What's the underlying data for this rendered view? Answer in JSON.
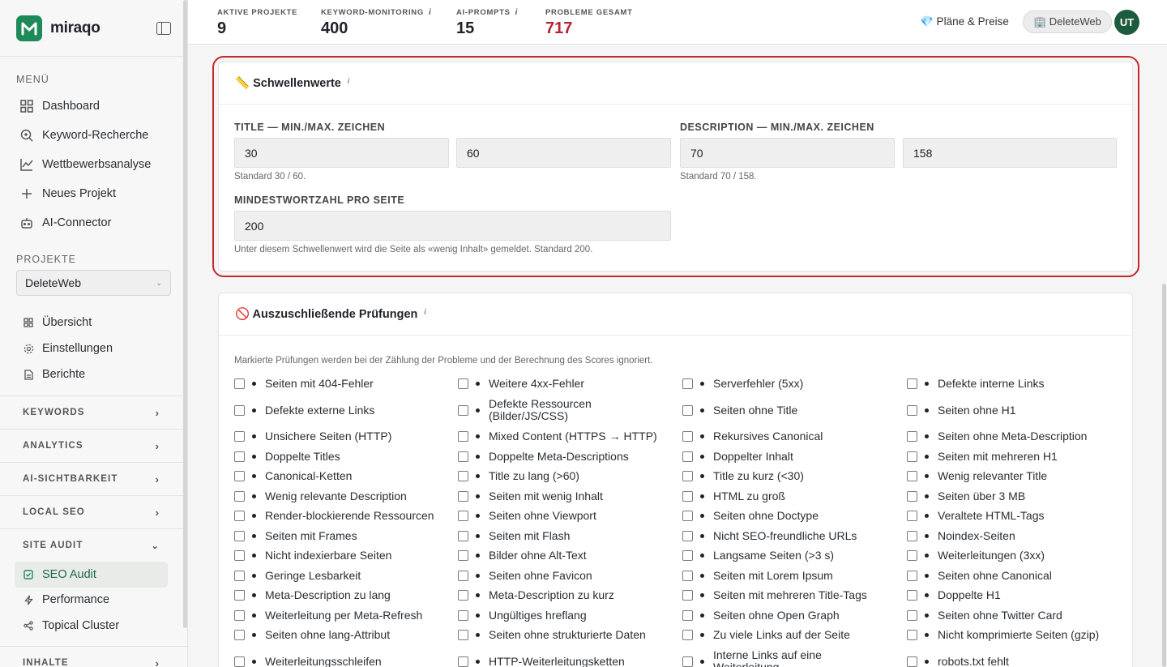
{
  "app": {
    "name": "miraqo"
  },
  "sidebar": {
    "menu_title": "MENÜ",
    "menu": [
      {
        "label": "Dashboard",
        "icon": "grid-icon"
      },
      {
        "label": "Keyword-Recherche",
        "icon": "search-icon"
      },
      {
        "label": "Wettbewerbsanalyse",
        "icon": "chart-line-icon"
      },
      {
        "label": "Neues Projekt",
        "icon": "plus-icon"
      },
      {
        "label": "AI-Connector",
        "icon": "robot-icon"
      }
    ],
    "projects_title": "PROJEKTE",
    "project_select": "DeleteWeb",
    "project_items": [
      {
        "label": "Übersicht",
        "icon": "grid-icon"
      },
      {
        "label": "Einstellungen",
        "icon": "gear-icon"
      },
      {
        "label": "Berichte",
        "icon": "document-icon"
      }
    ],
    "groups": [
      "KEYWORDS",
      "ANALYTICS",
      "AI-SICHTBARKEIT",
      "LOCAL SEO"
    ],
    "site_audit": {
      "title": "SITE AUDIT",
      "items": [
        {
          "label": "SEO Audit",
          "icon": "check-square-icon",
          "active": true
        },
        {
          "label": "Performance",
          "icon": "bolt-icon"
        },
        {
          "label": "Topical Cluster",
          "icon": "share-icon"
        }
      ]
    },
    "inhalte": "INHALTE"
  },
  "topbar": {
    "kpis": [
      {
        "label": "AKTIVE PROJEKTE",
        "value": "9",
        "info": ""
      },
      {
        "label": "KEYWORD-MONITORING",
        "value": "400",
        "info": "i"
      },
      {
        "label": "AI-PROMPTS",
        "value": "15",
        "info": "i"
      },
      {
        "label": "PROBLEME GESAMT",
        "value": "717",
        "info": ""
      }
    ],
    "plans": "💎 Pläne & Preise",
    "project": "🏢 DeleteWeb",
    "avatar": "UT",
    "colors": {
      "problems": "#b3262d",
      "avatar": "#1d5b3f",
      "brand": "#1e8a5a"
    }
  },
  "thresholds": {
    "title": "📏 Schwellenwerte",
    "info": "i",
    "title_label": "TITLE — MIN./MAX. ZEICHEN",
    "title_min": "30",
    "title_max": "60",
    "title_hint": "Standard 30 / 60.",
    "desc_label": "DESCRIPTION — MIN./MAX. ZEICHEN",
    "desc_min": "70",
    "desc_max": "158",
    "desc_hint": "Standard 70 / 158.",
    "words_label": "MINDESTWORTZAHL PRO SEITE",
    "words_value": "200",
    "words_hint": "Unter diesem Schwellenwert wird die Seite als «wenig Inhalt» gemeldet. Standard 200."
  },
  "exclusions": {
    "title": "🚫 Auszuschließende Prüfungen",
    "info": "i",
    "description": "Markierte Prüfungen werden bei der Zählung der Probleme und der Berechnung des Scores ignoriert.",
    "rows": [
      [
        "Seiten mit 404-Fehler",
        "Weitere 4xx-Fehler",
        "Serverfehler (5xx)",
        "Defekte interne Links"
      ],
      [
        "Defekte externe Links",
        "Defekte Ressourcen (Bilder/JS/CSS)",
        "Seiten ohne Title",
        "Seiten ohne H1"
      ],
      [
        "Unsichere Seiten (HTTP)",
        "Mixed Content (HTTPS → HTTP)",
        "Rekursives Canonical",
        "Seiten ohne Meta-Description"
      ],
      [
        "Doppelte Titles",
        "Doppelte Meta-Descriptions",
        "Doppelter Inhalt",
        "Seiten mit mehreren H1"
      ],
      [
        "Canonical-Ketten",
        "Title zu lang (>60)",
        "Title zu kurz (<30)",
        "Wenig relevanter Title"
      ],
      [
        "Wenig relevante Description",
        "Seiten mit wenig Inhalt",
        "HTML zu groß",
        "Seiten über 3 MB"
      ],
      [
        "Render-blockierende Ressourcen",
        "Seiten ohne Viewport",
        "Seiten ohne Doctype",
        "Veraltete HTML-Tags"
      ],
      [
        "Seiten mit Frames",
        "Seiten mit Flash",
        "Nicht SEO-freundliche URLs",
        "Noindex-Seiten"
      ],
      [
        "Nicht indexierbare Seiten",
        "Bilder ohne Alt-Text",
        "Langsame Seiten (>3 s)",
        "Weiterleitungen (3xx)"
      ],
      [
        "Geringe Lesbarkeit",
        "Seiten ohne Favicon",
        "Seiten mit Lorem Ipsum",
        "Seiten ohne Canonical"
      ],
      [
        "Meta-Description zu lang",
        "Meta-Description zu kurz",
        "Seiten mit mehreren Title-Tags",
        "Doppelte H1"
      ],
      [
        "Weiterleitung per Meta-Refresh",
        "Ungültiges hreflang",
        "Seiten ohne Open Graph",
        "Seiten ohne Twitter Card"
      ],
      [
        "Seiten ohne lang-Attribut",
        "Seiten ohne strukturierte Daten",
        "Zu viele Links auf der Seite",
        "Nicht komprimierte Seiten (gzip)"
      ],
      [
        "Weiterleitungsschleifen",
        "HTTP-Weiterleitungsketten",
        "Interne Links auf eine Weiterleitung",
        "robots.txt fehlt"
      ]
    ]
  }
}
